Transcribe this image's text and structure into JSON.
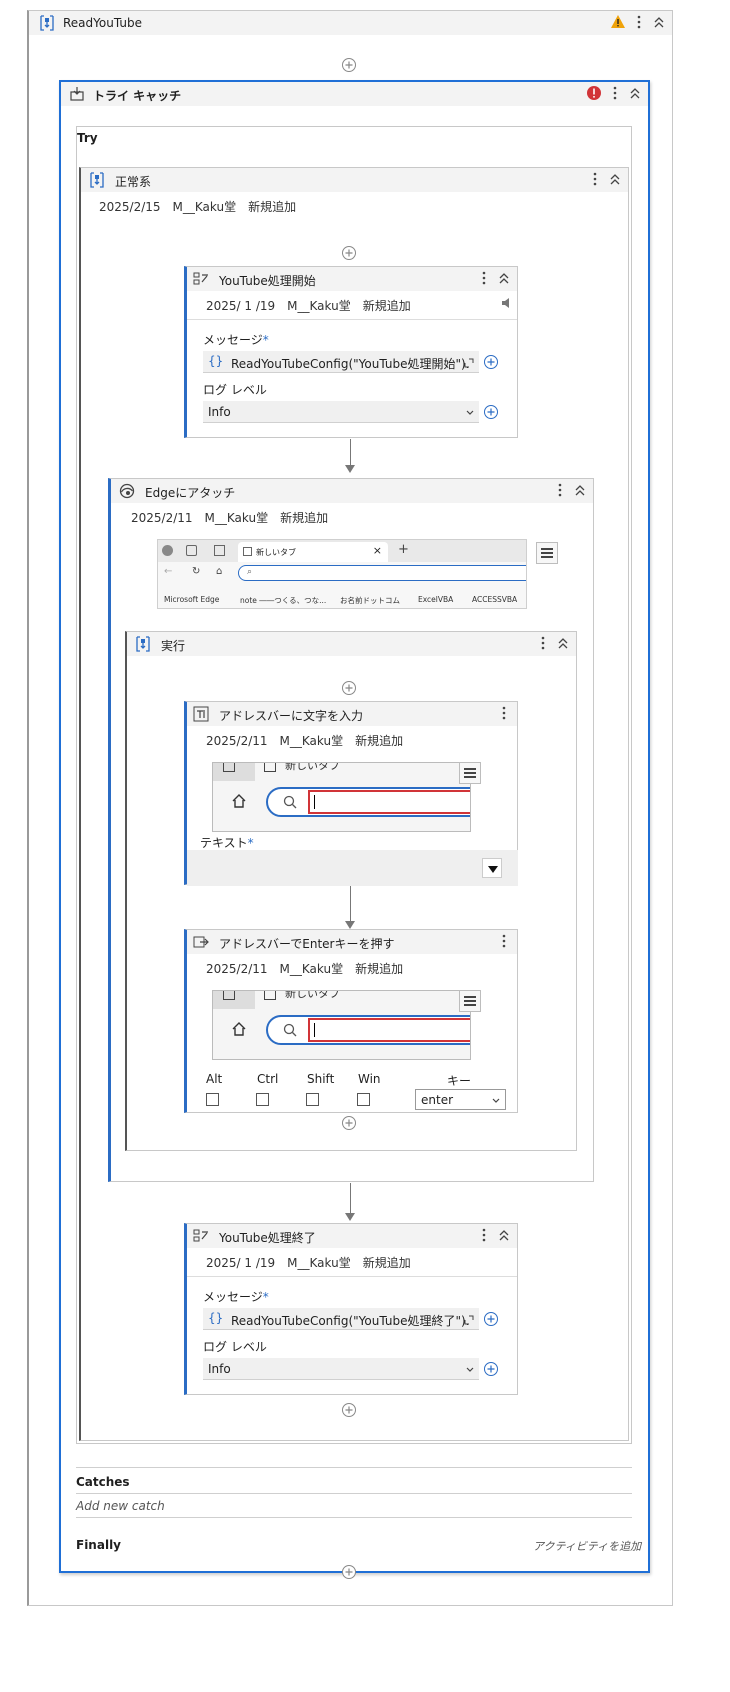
{
  "workflow": {
    "title": "ReadYouTube"
  },
  "try_catch": {
    "title": "トライ キャッチ",
    "try_label": "Try",
    "catches_label": "Catches",
    "add_catch_placeholder": "Add new catch",
    "finally_label": "Finally",
    "add_activity_label": "アクティビティを追加"
  },
  "normal": {
    "title": "正常系",
    "meta": "2025/2/15　M__Kaku堂　新規追加"
  },
  "log_start": {
    "title": "YouTube処理開始",
    "meta": "2025/ 1 /19　M__Kaku堂　新規追加",
    "message_label": "メッセージ",
    "message_value": "ReadYouTubeConfig(\"YouTube処理開始\").",
    "level_label": "ログ レベル",
    "level_value": "Info"
  },
  "attach": {
    "title": "Edgeにアタッチ",
    "meta": "2025/2/11　M__Kaku堂　新規追加",
    "tab_title": "新しいタブ",
    "bookmarks": [
      "Microsoft Edge",
      "note ――つくる、つな...",
      "お名前ドットコム",
      "ExcelVBA",
      "ACCESSVBA"
    ]
  },
  "exec": {
    "title": "実行"
  },
  "type_into": {
    "title": "アドレスバーに文字を入力",
    "meta": "2025/2/11　M__Kaku堂　新規追加",
    "thumb_tab": "新しいタブ",
    "text_label": "テキスト"
  },
  "press_enter": {
    "title": "アドレスバーでEnterキーを押す",
    "meta": "2025/2/11　M__Kaku堂　新規追加",
    "thumb_tab": "新しいタブ",
    "mods": [
      "Alt",
      "Ctrl",
      "Shift",
      "Win"
    ],
    "key_label": "キー",
    "key_value": "enter"
  },
  "log_end": {
    "title": "YouTube処理終了",
    "meta": "2025/ 1 /19　M__Kaku堂　新規追加",
    "message_label": "メッセージ",
    "message_value": "ReadYouTubeConfig(\"YouTube処理終了\").",
    "level_label": "ログ レベル",
    "level_value": "Info"
  },
  "required_mark": "*",
  "colors": {
    "accent": "#2b6cc4",
    "selected_border": "#1f6fd6",
    "warning": "#f0a30a",
    "error": "#d13438",
    "header_bg": "#f3f3f3"
  }
}
